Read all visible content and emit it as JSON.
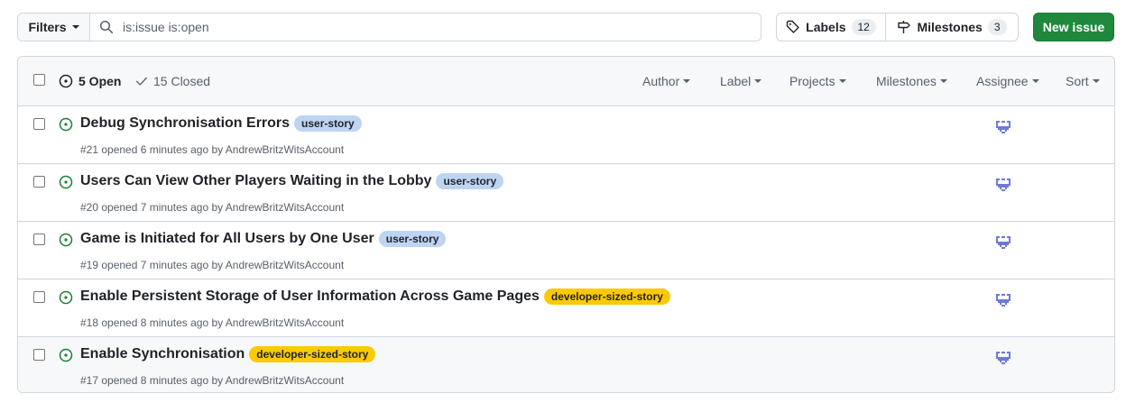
{
  "toolbar": {
    "filters_label": "Filters",
    "search_value": "is:issue is:open",
    "labels_label": "Labels",
    "labels_count": "12",
    "milestones_label": "Milestones",
    "milestones_count": "3",
    "new_issue_label": "New issue",
    "new_issue_color": "#1f883d"
  },
  "header": {
    "open_label": "5 Open",
    "closed_label": "15 Closed",
    "filters": [
      "Author",
      "Label",
      "Projects",
      "Milestones",
      "Assignee",
      "Sort"
    ]
  },
  "issues": [
    {
      "title": "Debug Synchronisation Errors",
      "label": "user-story",
      "meta": "#21 opened 6 minutes ago by AndrewBritzWitsAccount"
    },
    {
      "title": "Users Can View Other Players Waiting in the Lobby",
      "label": "user-story",
      "meta": "#20 opened 7 minutes ago by AndrewBritzWitsAccount"
    },
    {
      "title": "Game is Initiated for All Users by One User",
      "label": "user-story",
      "meta": "#19 opened 7 minutes ago by AndrewBritzWitsAccount"
    },
    {
      "title": "Enable Persistent Storage of User Information Across Game Pages",
      "label": "developer-sized-story",
      "meta": "#18 opened 8 minutes ago by AndrewBritzWitsAccount"
    },
    {
      "title": "Enable Synchronisation",
      "label": "developer-sized-story",
      "meta": "#17 opened 8 minutes ago by AndrewBritzWitsAccount"
    }
  ],
  "colors": {
    "open_icon": "#1a7f37",
    "user_story_label": "#bfd4f2",
    "developer_sized_story_label": "#fbca04",
    "avatar": "#6f7ad6"
  },
  "icons": {
    "search": "search-icon",
    "labels": "tag-icon",
    "milestones": "milestone-icon",
    "open": "issue-opened-icon",
    "closed": "check-icon",
    "assignee": "assignee-avatar"
  }
}
